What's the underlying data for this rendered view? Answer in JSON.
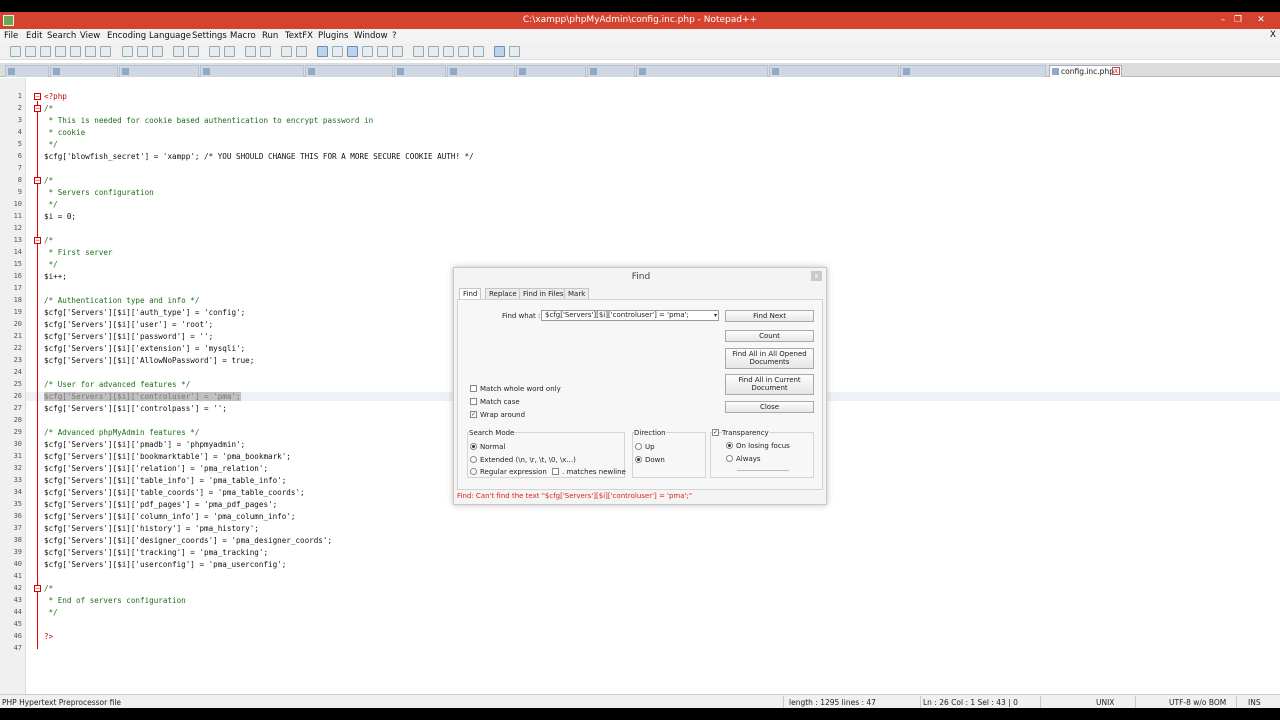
{
  "window": {
    "title": "C:\\xampp\\phpMyAdmin\\config.inc.php - Notepad++",
    "minimize": "–",
    "maximize": "❐",
    "close": "✕"
  },
  "menu": [
    "File",
    "Edit",
    "Search",
    "View",
    "Encoding",
    "Language",
    "Settings",
    "Macro",
    "Run",
    "TextFX",
    "Plugins",
    "Window",
    "?"
  ],
  "menu_close": "X",
  "tabs": {
    "active_label": "config.inc.php",
    "close": "x"
  },
  "editor": {
    "line_numbers": [
      "1",
      "2",
      "3",
      "4",
      "5",
      "6",
      "7",
      "8",
      "9",
      "10",
      "11",
      "12",
      "13",
      "14",
      "15",
      "16",
      "17",
      "18",
      "19",
      "20",
      "21",
      "22",
      "23",
      "24",
      "25",
      "26",
      "27",
      "28",
      "29",
      "30",
      "31",
      "32",
      "33",
      "34",
      "35",
      "36",
      "37",
      "38",
      "39",
      "40",
      "41",
      "42",
      "43",
      "44",
      "45",
      "46",
      "47"
    ],
    "lines": [
      "<?php",
      "/*",
      " * This is needed for cookie based authentication to encrypt password in",
      " * cookie",
      " */",
      "$cfg['blowfish_secret'] = 'xampp'; /* YOU SHOULD CHANGE THIS FOR A MORE SECURE COOKIE AUTH! */",
      "",
      "/*",
      " * Servers configuration",
      " */",
      "$i = 0;",
      "",
      "/*",
      " * First server",
      " */",
      "$i++;",
      "",
      "/* Authentication type and info */",
      "$cfg['Servers'][$i]['auth_type'] = 'config';",
      "$cfg['Servers'][$i]['user'] = 'root';",
      "$cfg['Servers'][$i]['password'] = '';",
      "$cfg['Servers'][$i]['extension'] = 'mysqli';",
      "$cfg['Servers'][$i]['AllowNoPassword'] = true;",
      "",
      "/* User for advanced features */",
      "$cfg['Servers'][$i]['controluser'] = 'pma';",
      "$cfg['Servers'][$i]['controlpass'] = '';",
      "",
      "/* Advanced phpMyAdmin features */",
      "$cfg['Servers'][$i]['pmadb'] = 'phpmyadmin';",
      "$cfg['Servers'][$i]['bookmarktable'] = 'pma_bookmark';",
      "$cfg['Servers'][$i]['relation'] = 'pma_relation';",
      "$cfg['Servers'][$i]['table_info'] = 'pma_table_info';",
      "$cfg['Servers'][$i]['table_coords'] = 'pma_table_coords';",
      "$cfg['Servers'][$i]['pdf_pages'] = 'pma_pdf_pages';",
      "$cfg['Servers'][$i]['column_info'] = 'pma_column_info';",
      "$cfg['Servers'][$i]['history'] = 'pma_history';",
      "$cfg['Servers'][$i]['designer_coords'] = 'pma_designer_coords';",
      "$cfg['Servers'][$i]['tracking'] = 'pma_tracking';",
      "$cfg['Servers'][$i]['userconfig'] = 'pma_userconfig';",
      "",
      "/*",
      " * End of servers configuration",
      " */",
      "",
      "?>",
      ""
    ],
    "selected_line": 26
  },
  "find_dialog": {
    "title": "Find",
    "close": "x",
    "tabs": [
      "Find",
      "Replace",
      "Find in Files",
      "Mark"
    ],
    "find_what_label": "Find what :",
    "find_what_value": "$cfg['Servers'][$i]['controluser'] = 'pma';",
    "buttons": {
      "find_next": "Find Next",
      "count": "Count",
      "find_all_opened": "Find All in All Opened Documents",
      "find_all_current": "Find All in Current Document",
      "close": "Close"
    },
    "options": {
      "match_whole_word": "Match whole word only",
      "match_case": "Match case",
      "wrap_around": "Wrap around"
    },
    "search_mode": {
      "title": "Search Mode",
      "normal": "Normal",
      "extended": "Extended (\\n, \\r, \\t, \\0, \\x...)",
      "regex": "Regular expression",
      "matches_newline": ". matches newline"
    },
    "direction": {
      "title": "Direction",
      "up": "Up",
      "down": "Down"
    },
    "transparency": {
      "title": "Transparency",
      "on_losing_focus": "On losing focus",
      "always": "Always"
    },
    "status": "Find: Can't find the text \"$cfg['Servers'][$i]['controluser'] = 'pma';\""
  },
  "statusbar": {
    "file_type": "PHP Hypertext Preprocessor file",
    "length": "length : 1295    lines : 47",
    "position": "Ln : 26    Col : 1    Sel : 43 | 0",
    "eol": "UNIX",
    "encoding": "UTF-8 w/o BOM",
    "mode": "INS"
  }
}
